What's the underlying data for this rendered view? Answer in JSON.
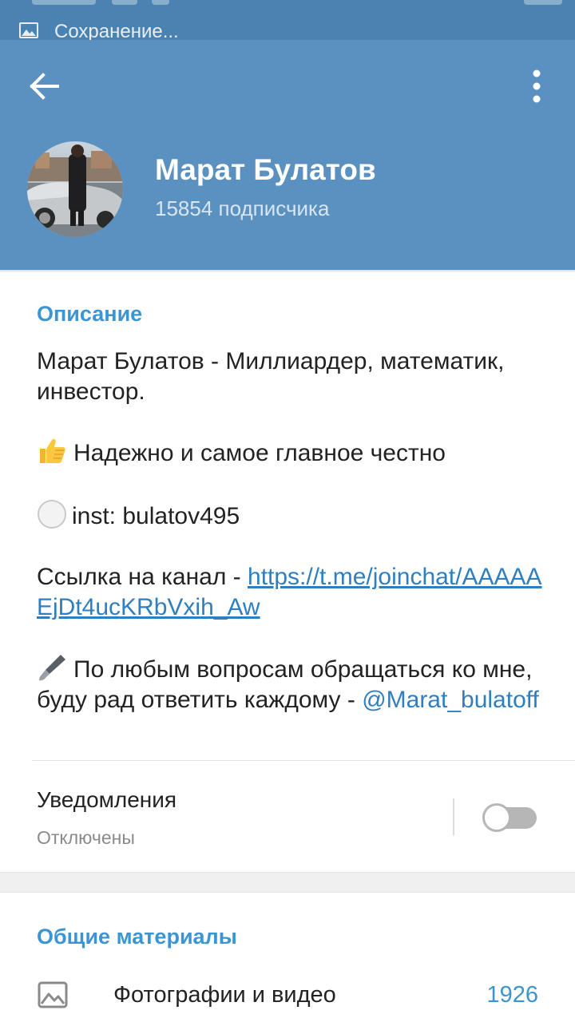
{
  "status_bar": {
    "notification_text": "Сохранение...",
    "icon": "image-icon"
  },
  "header": {
    "back_icon": "arrow-left-icon",
    "menu_icon": "more-vertical-icon",
    "channel_name": "Марат Булатов",
    "subscribers": "15854 подписчика",
    "avatar": "avatar-photo",
    "colors": {
      "header_bg": "#5b91c0",
      "status_bg": "#4a83b1",
      "accent": "#3a95d5"
    }
  },
  "description": {
    "title": "Описание",
    "line1": "Марат Булатов - Миллиардер, математик, инвестор.",
    "line2_emoji": "thumbs-up-icon",
    "line2": "Надежно и самое главное честно",
    "line3_emoji": "white-circle-icon",
    "line3": "inst: bulatov495",
    "line4_prefix": "Ссылка на канал - ",
    "line4_link": "https://t.me/joinchat/AAAAAEjDt4ucKRbVxih_Aw",
    "line5_emoji": "paintbrush-icon",
    "line5": "По любым вопросам обращаться ко мне, буду рад ответить каждому - ",
    "line5_mention": "@Marat_bulatoff"
  },
  "notifications": {
    "title": "Уведомления",
    "status": "Отключены",
    "enabled": false
  },
  "shared_media": {
    "title": "Общие материалы",
    "items": [
      {
        "label": "Фотографии и видео",
        "count": "1926",
        "icon": "image-icon"
      }
    ]
  }
}
